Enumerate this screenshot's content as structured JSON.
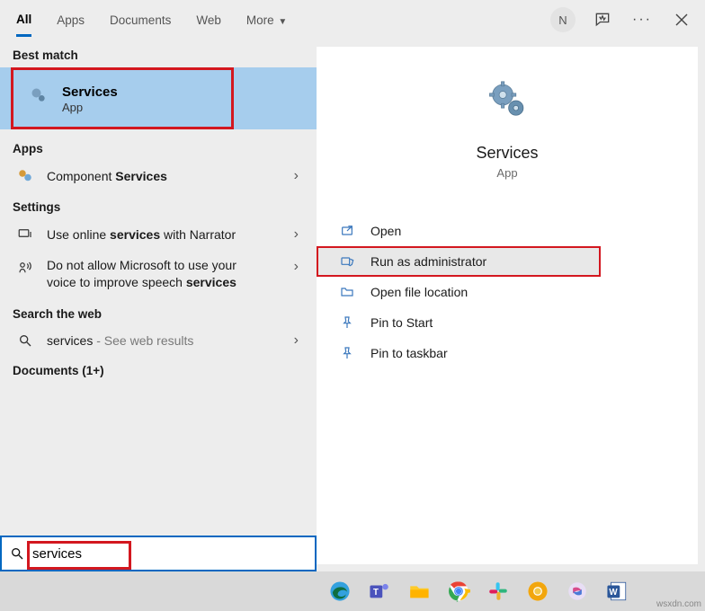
{
  "tabs": {
    "all": "All",
    "apps": "Apps",
    "documents": "Documents",
    "web": "Web",
    "more": "More"
  },
  "avatar_letter": "N",
  "sections": {
    "best_match": "Best match",
    "apps": "Apps",
    "settings": "Settings",
    "search_web": "Search the web",
    "documents": "Documents (1+)"
  },
  "best_match": {
    "title": "Services",
    "subtitle": "App"
  },
  "results": {
    "component_services_pre": "Component ",
    "component_services_bold": "Services",
    "narrator_pre": "Use online ",
    "narrator_bold": "services",
    "narrator_post": " with Narrator",
    "speech_pre": "Do not allow Microsoft to use your voice to improve speech ",
    "speech_bold": "services",
    "web_term": "services",
    "web_suffix": " - See web results"
  },
  "detail": {
    "title": "Services",
    "subtitle": "App",
    "actions": {
      "open": "Open",
      "run_admin": "Run as administrator",
      "open_location": "Open file location",
      "pin_start": "Pin to Start",
      "pin_taskbar": "Pin to taskbar"
    }
  },
  "search": {
    "value": "services"
  },
  "watermark": "wsxdn.com"
}
